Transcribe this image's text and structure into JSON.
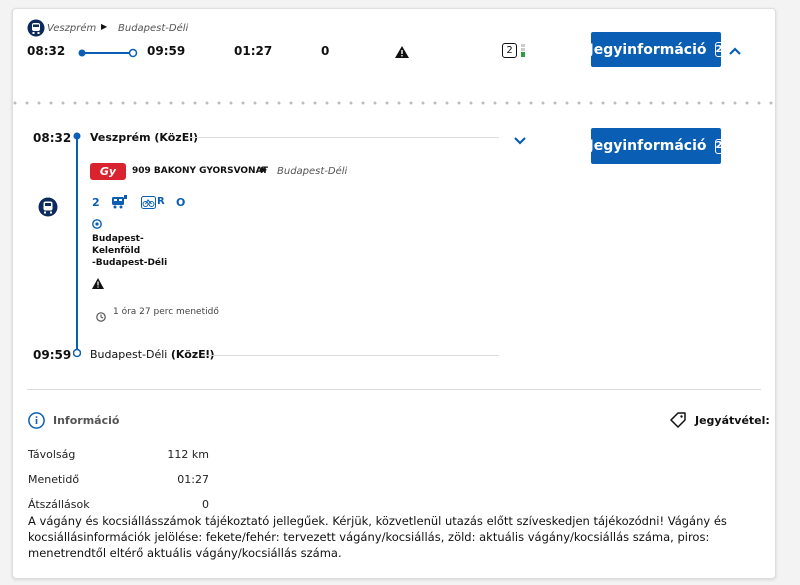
{
  "summary": {
    "from": "Veszprém",
    "to": "Budapest-Déli",
    "depart": "08:32",
    "arrive": "09:59",
    "duration": "01:27",
    "transfers": "0",
    "seat_count": "2",
    "ticket_button_label": "Jegyinformáció",
    "ticket_button_count": "2"
  },
  "detail": {
    "depart_time": "08:32",
    "depart_station": "Veszprém (KözEl)",
    "train_logo": "Gy",
    "train_name": "909 BAKONY GYORSVONAT",
    "train_destination": "Budapest-Déli",
    "track_number": "2",
    "bike_label": "R",
    "zero_label": "O",
    "via_line1": "Budapest-",
    "via_line2": "Kelenföld",
    "via_line3": "-Budapest-Déli",
    "travel_time": "1 óra 27 perc  menetidő",
    "arrive_time": "09:59",
    "arrive_station_prefix": "Budapest-Déli ",
    "arrive_station_bold": "(KözEl)",
    "ticket_button_label": "Jegyinformáció",
    "ticket_button_count": "2"
  },
  "info": {
    "heading": "Információ",
    "ticket_pickup_label": "Jegyátvétel:",
    "rows": [
      {
        "label": "Távolság",
        "value": "112 km"
      },
      {
        "label": "Menetidő",
        "value": "01:27"
      },
      {
        "label": "Átszállások",
        "value": "0"
      }
    ],
    "note": "A vágány és kocsiállásszámok tájékoztató jellegűek. Kérjük, közvetlenül utazás előtt szíveskedjen tájékozódni! Vágány és kocsiállásinformációk jelölése: fekete/fehér: tervezett vágány/kocsiállás, zöld: aktuális vágány/kocsiállás száma, piros: menetrendtől eltérő aktuális vágány/kocsiállás száma."
  },
  "colors": {
    "accent": "#0a5fb4",
    "train_logo_red": "#d9232e",
    "seat_green": "#2e9e44"
  }
}
